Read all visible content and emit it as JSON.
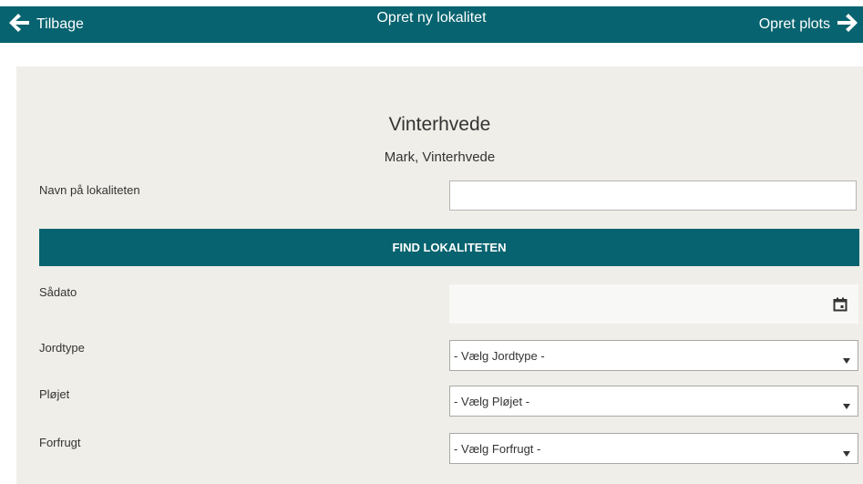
{
  "header": {
    "back_label": "Tilbage",
    "title": "Opret ny lokalitet",
    "next_label": "Opret plots"
  },
  "form": {
    "heading": "Vinterhvede",
    "subheading": "Mark, Vinterhvede",
    "name_label": "Navn på lokaliteten",
    "name_value": "",
    "find_button": "FIND LOKALITETEN",
    "sow_date_label": "Sådato",
    "sow_date_value": "",
    "soil_label": "Jordtype",
    "soil_value": "- Vælg Jordtype -",
    "plowed_label": "Pløjet",
    "plowed_value": "- Vælg Pløjet -",
    "previous_crop_label": "Forfrugt",
    "previous_crop_value": "- Vælg Forfrugt -"
  },
  "colors": {
    "brand": "#07636f",
    "panel": "#f0eee8"
  }
}
